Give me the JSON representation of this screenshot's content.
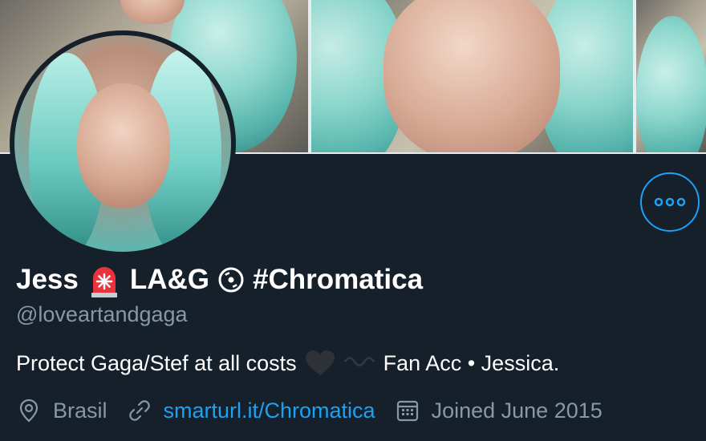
{
  "profile": {
    "display_name_first": "Jess",
    "display_name_second": "LA&G",
    "display_name_third": "#Chromatica",
    "handle": "@loveartandgaga",
    "bio_part1": "Protect Gaga/Stef at all costs",
    "bio_part2": "Fan Acc • Jessica.",
    "location": "Brasil",
    "website": "smarturl.it/Chromatica",
    "joined": "Joined June 2015"
  },
  "icons": {
    "emoji1": "police-light-icon",
    "emoji2": "record-disc-icon",
    "heart": "black-heart-icon",
    "wave": "wave-dash-icon",
    "location": "location-pin-icon",
    "link": "link-icon",
    "calendar": "calendar-icon",
    "more": "more-options-icon"
  },
  "colors": {
    "background": "#15202b",
    "accent": "#1da1f2",
    "secondary_text": "#8899a6",
    "primary_text": "#ffffff"
  }
}
